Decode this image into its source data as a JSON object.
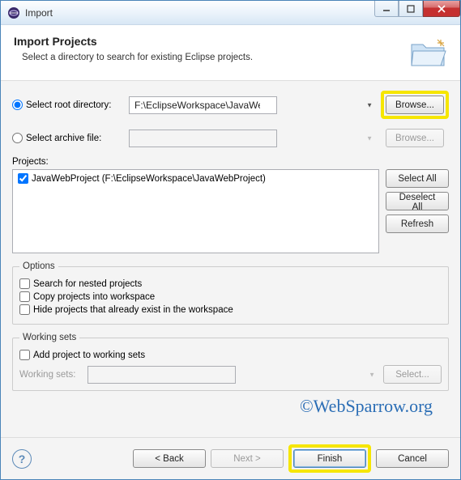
{
  "window": {
    "title": "Import"
  },
  "header": {
    "title": "Import Projects",
    "subtitle": "Select a directory to search for existing Eclipse projects."
  },
  "source": {
    "root_radio_label": "Select root directory:",
    "root_dir_value": "F:\\EclipseWorkspace\\JavaWebProject",
    "archive_radio_label": "Select archive file:",
    "archive_value": "",
    "browse_label": "Browse...",
    "browse_disabled_label": "Browse..."
  },
  "projects": {
    "label": "Projects:",
    "items": [
      {
        "checked": true,
        "label": "JavaWebProject (F:\\EclipseWorkspace\\JavaWebProject)"
      }
    ],
    "select_all": "Select All",
    "deselect_all": "Deselect All",
    "refresh": "Refresh"
  },
  "options": {
    "legend": "Options",
    "nested": "Search for nested projects",
    "copy": "Copy projects into workspace",
    "hide": "Hide projects that already exist in the workspace"
  },
  "working_sets": {
    "legend": "Working sets",
    "add": "Add project to working sets",
    "label": "Working sets:",
    "select": "Select..."
  },
  "watermark": "©WebSparrow.org",
  "footer": {
    "back": "< Back",
    "next": "Next >",
    "finish": "Finish",
    "cancel": "Cancel"
  }
}
